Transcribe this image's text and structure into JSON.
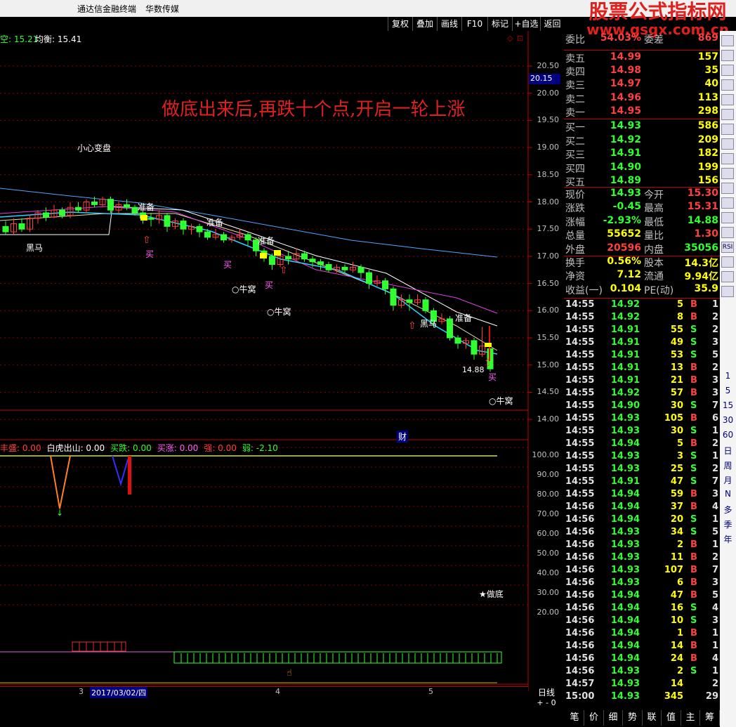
{
  "titlebar": {
    "app": "通达信金融终端",
    "product": "华数传媒"
  },
  "watermark": {
    "title": "股票公式指标网",
    "url": "www.gsgx.com.cn"
  },
  "toolbar": {
    "buttons": [
      "复权",
      "叠加",
      "画线",
      "F10",
      "标记",
      "+自选",
      "返回"
    ]
  },
  "header": {
    "left_text": "空: 15.21",
    "balance_label": "均衡: 15.41"
  },
  "annotation": {
    "headline": "做底出来后,再跌十个点,开启一轮上涨",
    "caution": "小心变盘"
  },
  "price_axis": {
    "ticks": [
      "20.50",
      "20.15",
      "20.00",
      "19.50",
      "19.00",
      "18.50",
      "18.00",
      "17.50",
      "17.00",
      "16.50",
      "16.00",
      "15.50",
      "15.00",
      "14.50",
      "14.00"
    ],
    "highlight": "20.15",
    "last_price_label": "14.88"
  },
  "chart_labels": {
    "heima1": "黑马",
    "heima2": "黑马",
    "zhunbei1": "准备",
    "zhunbei2": "准备",
    "zhunbei3": "准备",
    "zhunbei4": "准备",
    "mai1": "买",
    "mai2": "买",
    "mai3": "买",
    "mai4": "买",
    "niuwo1": "牛窝",
    "niuwo2": "牛窝",
    "niuwo3": "牛窝",
    "cai": "财"
  },
  "indicator": {
    "legend": [
      {
        "label": "丰盛: 0.00",
        "color": "#ff4040"
      },
      {
        "label": "白虎出山: 0.00",
        "color": "#ffffff"
      },
      {
        "label": "买跌: 0.00",
        "color": "#30ff30"
      },
      {
        "label": "买涨: 0.00",
        "color": "#ff60ff"
      },
      {
        "label": "强: 0.00",
        "color": "#ff4040"
      },
      {
        "label": "弱: -2.10",
        "color": "#30ff30"
      }
    ],
    "ticks": [
      "100.00",
      "90.00",
      "80.00",
      "70.00",
      "60.00",
      "50.00",
      "40.00",
      "30.00",
      "20.00"
    ],
    "zuodi": "★做底"
  },
  "date_axis": {
    "label3": "3",
    "date": "2017/03/02/四",
    "label4": "4",
    "label5": "5",
    "period": "日线",
    "zoom": "+ - 0"
  },
  "orderbook": {
    "weibi": {
      "label": "委比",
      "value": "54.03%",
      "label2": "委差",
      "value2": "869"
    },
    "sell": [
      {
        "label": "卖五",
        "price": "14.99",
        "vol": "157"
      },
      {
        "label": "卖四",
        "price": "14.98",
        "vol": "35"
      },
      {
        "label": "卖三",
        "price": "14.97",
        "vol": "40"
      },
      {
        "label": "卖二",
        "price": "14.96",
        "vol": "113"
      },
      {
        "label": "卖一",
        "price": "14.95",
        "vol": "298"
      }
    ],
    "buy": [
      {
        "label": "买一",
        "price": "14.93",
        "vol": "586"
      },
      {
        "label": "买二",
        "price": "14.92",
        "vol": "209"
      },
      {
        "label": "买三",
        "price": "14.91",
        "vol": "182"
      },
      {
        "label": "买四",
        "price": "14.90",
        "vol": "199"
      },
      {
        "label": "买五",
        "price": "14.89",
        "vol": "156"
      }
    ],
    "stats": [
      {
        "l1": "现价",
        "v1": "14.93",
        "c1": "#30ff30",
        "l2": "今开",
        "v2": "15.30",
        "c2": "#ff4040"
      },
      {
        "l1": "涨跌",
        "v1": "-0.45",
        "c1": "#30ff30",
        "l2": "最高",
        "v2": "15.31",
        "c2": "#ff4040"
      },
      {
        "l1": "涨幅",
        "v1": "-2.93%",
        "c1": "#30ff30",
        "l2": "最低",
        "v2": "14.88",
        "c2": "#30ff30"
      },
      {
        "l1": "总量",
        "v1": "55652",
        "c1": "#ffff00",
        "l2": "量比",
        "v2": "1.30",
        "c2": "#ff4040"
      },
      {
        "l1": "外盘",
        "v1": "20596",
        "c1": "#ff4040",
        "l2": "内盘",
        "v2": "35056",
        "c2": "#30ff30"
      },
      {
        "l1": "换手",
        "v1": "0.56%",
        "c1": "#ffff00",
        "l2": "股本",
        "v2": "14.3亿",
        "c2": "#ffff00"
      },
      {
        "l1": "净资",
        "v1": "7.12",
        "c1": "#ffff00",
        "l2": "流通",
        "v2": "9.94亿",
        "c2": "#ffff00"
      },
      {
        "l1": "收益(一)",
        "v1": "0.104",
        "c1": "#ffff00",
        "l2": "PE(动)",
        "v2": "35.9",
        "c2": "#ffff00"
      }
    ]
  },
  "ticks": [
    [
      "14:55",
      "14.92",
      "5",
      "B",
      "1"
    ],
    [
      "14:55",
      "14.92",
      "8",
      "B",
      "2"
    ],
    [
      "14:55",
      "14.91",
      "55",
      "S",
      "2"
    ],
    [
      "14:55",
      "14.91",
      "49",
      "S",
      "3"
    ],
    [
      "14:55",
      "14.91",
      "53",
      "S",
      "5"
    ],
    [
      "14:55",
      "14.91",
      "13",
      "B",
      "2"
    ],
    [
      "14:55",
      "14.91",
      "21",
      "B",
      "3"
    ],
    [
      "14:55",
      "14.92",
      "57",
      "B",
      "3"
    ],
    [
      "14:55",
      "14.90",
      "30",
      "S",
      "7"
    ],
    [
      "14:55",
      "14.93",
      "105",
      "B",
      "6"
    ],
    [
      "14:55",
      "14.93",
      "30",
      "S",
      "1"
    ],
    [
      "14:55",
      "14.94",
      "5",
      "B",
      "2"
    ],
    [
      "14:55",
      "14.93",
      "3",
      "S",
      "1"
    ],
    [
      "14:55",
      "14.93",
      "25",
      "S",
      "2"
    ],
    [
      "14:55",
      "14.91",
      "47",
      "S",
      "7"
    ],
    [
      "14:55",
      "14.94",
      "59",
      "B",
      "3"
    ],
    [
      "14:56",
      "14.94",
      "37",
      "B",
      "4"
    ],
    [
      "14:56",
      "14.94",
      "20",
      "S",
      "1"
    ],
    [
      "14:56",
      "14.93",
      "34",
      "S",
      "5"
    ],
    [
      "14:56",
      "14.93",
      "2",
      "B",
      "1"
    ],
    [
      "14:56",
      "14.93",
      "11",
      "B",
      "2"
    ],
    [
      "14:56",
      "14.93",
      "107",
      "B",
      "7"
    ],
    [
      "14:56",
      "14.93",
      "6",
      "B",
      "3"
    ],
    [
      "14:56",
      "14.94",
      "47",
      "B",
      "5"
    ],
    [
      "14:56",
      "14.94",
      "16",
      "S",
      "4"
    ],
    [
      "14:56",
      "14.94",
      "10",
      "S",
      "3"
    ],
    [
      "14:56",
      "14.94",
      "1",
      "B",
      "1"
    ],
    [
      "14:56",
      "14.94",
      "14",
      "B",
      "1"
    ],
    [
      "14:56",
      "14.94",
      "24",
      "B",
      "4"
    ],
    [
      "14:56",
      "14.93",
      "2",
      "S",
      "1"
    ],
    [
      "14:57",
      "14.93",
      "14",
      "",
      "2"
    ],
    [
      "15:00",
      "14.93",
      "345",
      "",
      "29"
    ]
  ],
  "rightbar": {
    "icons": [
      "RSI"
    ],
    "texts": [
      "1",
      "5",
      "15",
      "30",
      "60",
      "日",
      "周",
      "月",
      "N",
      "多",
      "季",
      "年"
    ]
  },
  "bottomtabs": [
    "笔",
    "价",
    "细",
    "势",
    "联",
    "值",
    "主",
    "筹"
  ],
  "colors": {
    "up": "#ff4040",
    "down": "#30ff30",
    "accent": "#ffff00",
    "grid": "#8b0000",
    "axis": "#c00000"
  }
}
